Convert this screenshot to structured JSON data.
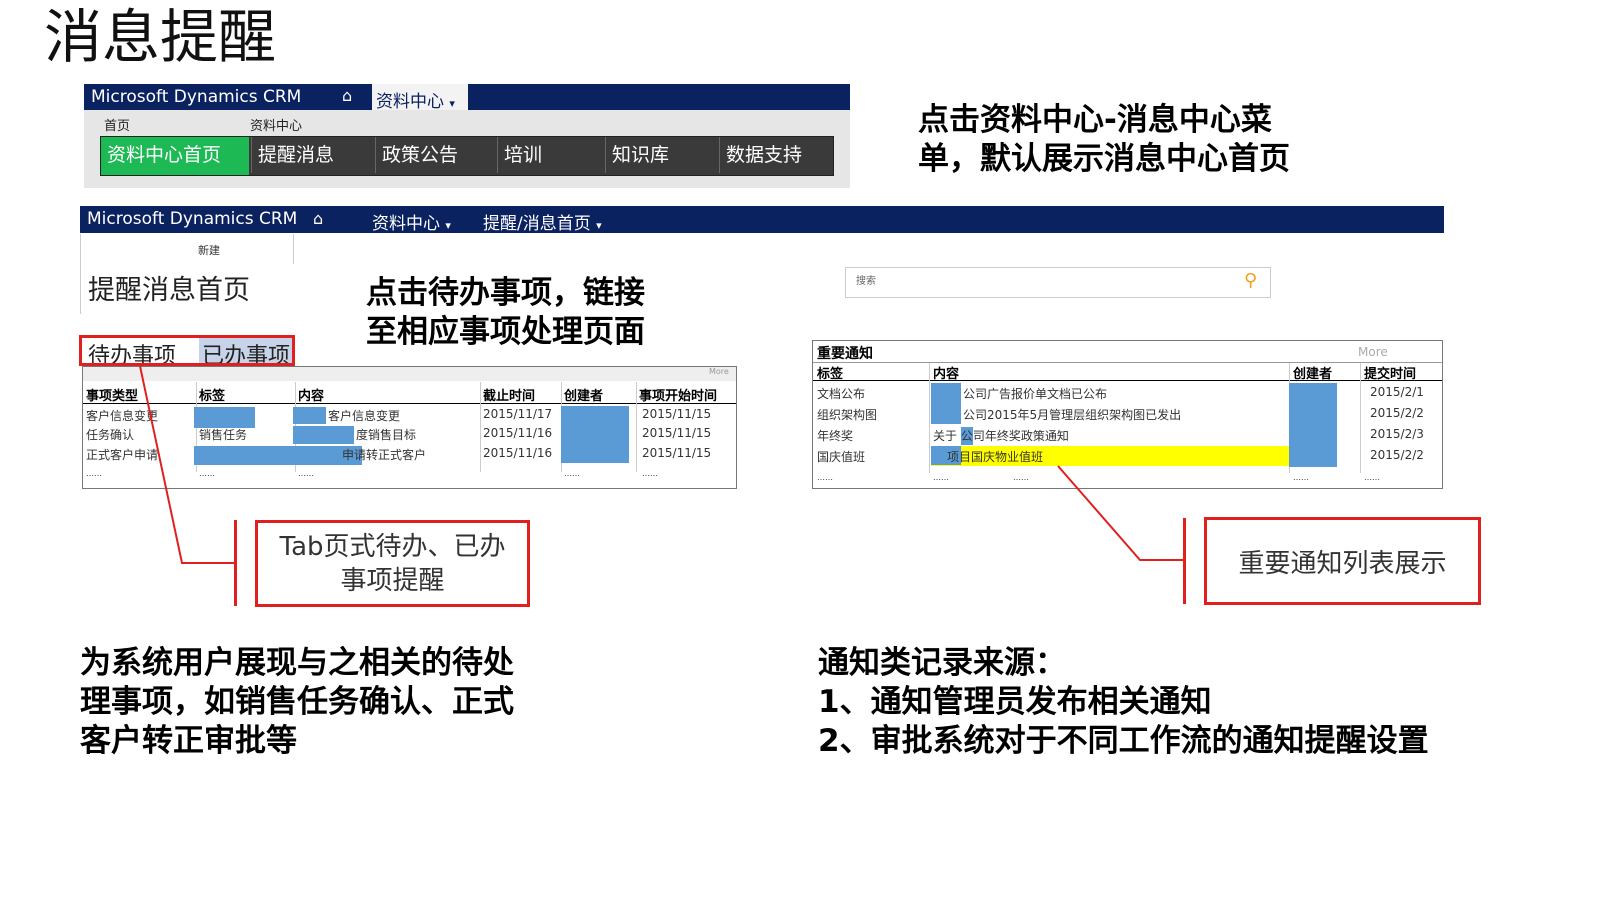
{
  "title": "消息提醒",
  "crm1": {
    "brand": "Microsoft Dynamics CRM",
    "home_icon": "home-icon",
    "menu": "资料中心",
    "crumb_home": "首页",
    "crumb_center": "资料中心",
    "tabs": [
      "资料中心首页",
      "提醒消息",
      "政策公告",
      "培训",
      "知识库",
      "数据支持"
    ]
  },
  "note1": [
    "点击资料中心-消息中心菜",
    "单，默认展示消息中心首页"
  ],
  "crm2": {
    "brand": "Microsoft Dynamics CRM",
    "menu1": "资料中心",
    "menu2": "提醒/消息首页",
    "new_label": "新建",
    "page_title": "提醒消息首页",
    "search_placeholder": "搜索"
  },
  "note2": [
    "点击待办事项，链接",
    "至相应事项处理页面"
  ],
  "todo_tabs": {
    "pending": "待办事项",
    "done": "已办事项"
  },
  "todo_table": {
    "more": "More",
    "headers": [
      "事项类型",
      "标签",
      "内容",
      "截止时间",
      "创建者",
      "事项开始时间"
    ],
    "rows": [
      {
        "type": "客户信息变更",
        "tag": "",
        "content": "客户信息变更",
        "due": "2015/11/17",
        "start": "2015/11/15"
      },
      {
        "type": "任务确认",
        "tag": "销售任务",
        "content": "度销售目标",
        "due": "2015/11/16",
        "start": "2015/11/15"
      },
      {
        "type": "正式客户申请",
        "tag": "",
        "content": "申请转正式客户",
        "due": "2015/11/16",
        "start": "2015/11/15"
      }
    ],
    "ellipsis": "……"
  },
  "notice_table": {
    "title": "重要通知",
    "more": "More",
    "headers": [
      "标签",
      "内容",
      "创建者",
      "提交时间"
    ],
    "rows": [
      {
        "tag": "文档公布",
        "content": "公司广告报价单文档已公布",
        "date": "2015/2/1"
      },
      {
        "tag": "组织架构图",
        "content": "公司2015年5月管理层组织架构图已发出",
        "date": "2015/2/2"
      },
      {
        "tag": "年终奖",
        "content": "关于   公司年终奖政策通知",
        "date": "2015/2/3"
      },
      {
        "tag": "国庆值班",
        "content": "项目国庆物业值班",
        "date": "2015/2/2"
      }
    ],
    "ellipsis": "……"
  },
  "callout_tab": "Tab页式待办、已办事项提醒",
  "callout_notice": "重要通知列表展示",
  "desc_left": [
    "为系统用户展现与之相关的待处",
    "理事项，如销售任务确认、正式",
    "客户转正审批等"
  ],
  "desc_right": [
    "通知类记录来源：",
    "1、通知管理员发布相关通知",
    "2、审批系统对于不同工作流的通知提醒设置"
  ],
  "colors": {
    "nav": "#0b2260",
    "tab_active": "#1db954",
    "tab": "#3a3a3a",
    "highlight": "#ffff00",
    "redact": "#5b9bd5",
    "callout": "#e0201f"
  }
}
